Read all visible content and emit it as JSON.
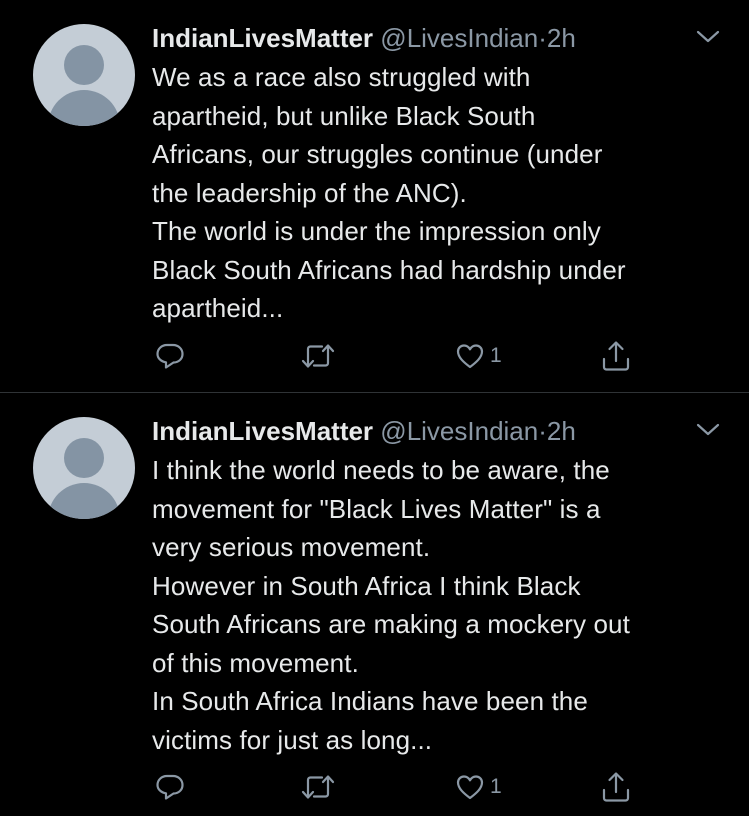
{
  "tweets": [
    {
      "author_name": "IndianLivesMatter",
      "handle": "@LivesIndian",
      "separator": "·",
      "time": "2h",
      "lines": [
        "We as a race also struggled with",
        "apartheid, but unlike Black South",
        "Africans, our struggles continue (under",
        "the leadership of the ANC).",
        "The world is under the impression only",
        "Black South Africans had hardship under",
        "apartheid..."
      ],
      "likes": "1"
    },
    {
      "author_name": "IndianLivesMatter",
      "handle": "@LivesIndian",
      "separator": "·",
      "time": "2h",
      "lines": [
        "I think the world needs to be aware, the",
        "movement for \"Black Lives Matter\" is a",
        "very serious movement.",
        "However in South Africa I think Black",
        "South Africans are making a mockery out",
        "of this movement.",
        "In South Africa Indians have been the",
        "victims for just as long..."
      ],
      "likes": "1"
    }
  ],
  "icons": {
    "reply": "reply-icon",
    "retweet": "retweet-icon",
    "like": "heart-icon",
    "share": "share-icon",
    "more": "chevron-down-icon"
  },
  "colors": {
    "background": "#000000",
    "text": "#e7e9ea",
    "secondary": "#8b98a5",
    "divider": "#2f3336",
    "avatar_bg": "#c4cdd6",
    "avatar_fg": "#8494a4"
  }
}
